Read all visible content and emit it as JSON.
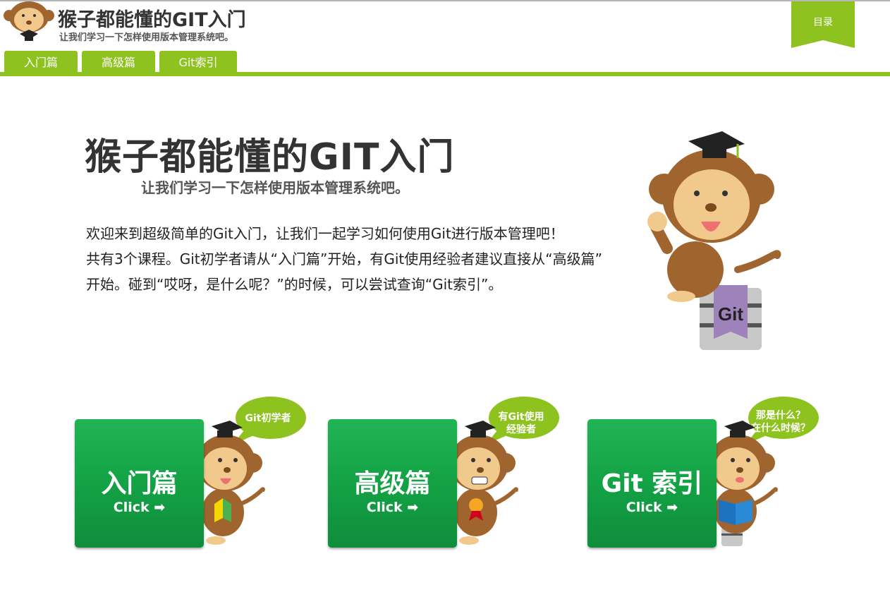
{
  "header": {
    "title": "猴子都能懂的GIT入门",
    "subtitle": "让我们学习一下怎样使用版本管理系统吧。",
    "toc_label": "目录"
  },
  "tabs": [
    {
      "label": "入门篇"
    },
    {
      "label": "高级篇"
    },
    {
      "label": "Git索引"
    }
  ],
  "hero": {
    "title": "猴子都能懂的GIT入门",
    "subtitle": "让我们学习一下怎样使用版本管理系统吧。",
    "badge": "Git",
    "intro_lines": [
      "欢迎来到超级简单的Git入门，让我们一起学习如何使用Git进行版本管理吧！",
      "共有3个课程。Git初学者请从“入门篇”开始，有Git使用经验者建议直接从“高级篇”",
      "开始。碰到“哎呀，是什么呢？”的时候，可以尝试查询“Git索引”。"
    ]
  },
  "courses": [
    {
      "label": "入门篇",
      "click": "Click ➡",
      "bubble_lines": [
        "Git初学者"
      ]
    },
    {
      "label": "高级篇",
      "click": "Click ➡",
      "bubble_lines": [
        "有Git使用",
        "经验者"
      ]
    },
    {
      "label": "Git 索引",
      "click": "Click ➡",
      "bubble_lines": [
        "那是什么？",
        "在什么时候？"
      ]
    }
  ],
  "colors": {
    "accent_green": "#8dc21f",
    "card_green": "#14a447",
    "monkey_fur": "#a0652e",
    "monkey_face": "#f2c98d",
    "badge_purple": "#9e83bb"
  },
  "icons": [
    "monkey-logo-icon",
    "monkey-mascot-icon",
    "arrow-right-icon",
    "graduation-cap-icon",
    "git-database-icon"
  ]
}
